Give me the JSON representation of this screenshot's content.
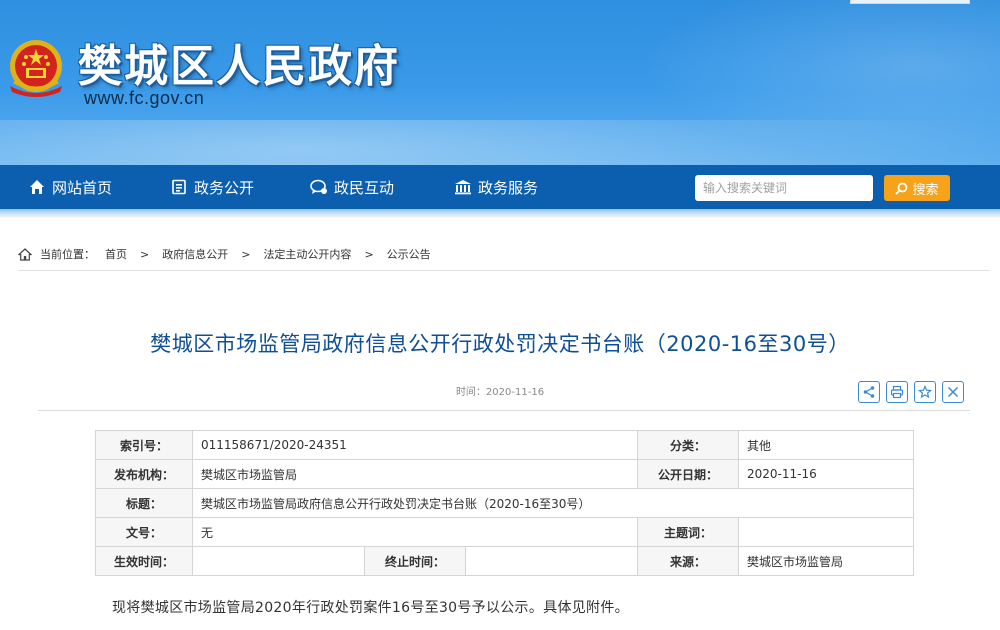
{
  "site": {
    "title": "樊城区人民政府",
    "url": "www.fc.gov.cn",
    "emblem_icon": "national-emblem-icon"
  },
  "nav": {
    "items": [
      {
        "label": "网站首页",
        "icon": "home-icon"
      },
      {
        "label": "政务公开",
        "icon": "document-list-icon"
      },
      {
        "label": "政民互动",
        "icon": "chat-bubble-icon"
      },
      {
        "label": "政务服务",
        "icon": "building-icon"
      }
    ],
    "search_placeholder": "输入搜索关键词",
    "search_label": "搜索",
    "colors": {
      "bar": "#0c5fae",
      "search_button": "#f7a21b"
    }
  },
  "breadcrumb": {
    "label": "当前位置：",
    "items": [
      "首页",
      "政府信息公开",
      "法定主动公开内容",
      "公示公告"
    ],
    "separator": ">"
  },
  "article": {
    "title": "樊城区市场监管局政府信息公开行政处罚决定书台账（2020-16至30号）",
    "time": "时间：2020-11-16",
    "tools": [
      "share-icon",
      "print-icon",
      "favorite-icon",
      "close-icon"
    ],
    "title_color": "#0e4f97"
  },
  "info_table": {
    "index_label": "索引号：",
    "index_value": "011158671/2020-24351",
    "category_label": "分类：",
    "category_value": "其他",
    "publisher_label": "发布机构：",
    "publisher_value": "樊城区市场监管局",
    "publish_date_label": "公开日期：",
    "publish_date_value": "2020-11-16",
    "title_label": "标题：",
    "title_value": "樊城区市场监管局政府信息公开行政处罚决定书台账（2020-16至30号）",
    "doc_no_label": "文号：",
    "doc_no_value": "无",
    "subject_label": "主题词：",
    "subject_value": "",
    "effective_label": "生效时间：",
    "effective_value": "",
    "expire_label": "终止时间：",
    "expire_value": "",
    "source_label": "来源：",
    "source_value": "樊城区市场监管局"
  },
  "content": {
    "paragraph": "现将樊城区市场监管局2020年行政处罚案件16号至30号予以公示。具体见附件。"
  }
}
